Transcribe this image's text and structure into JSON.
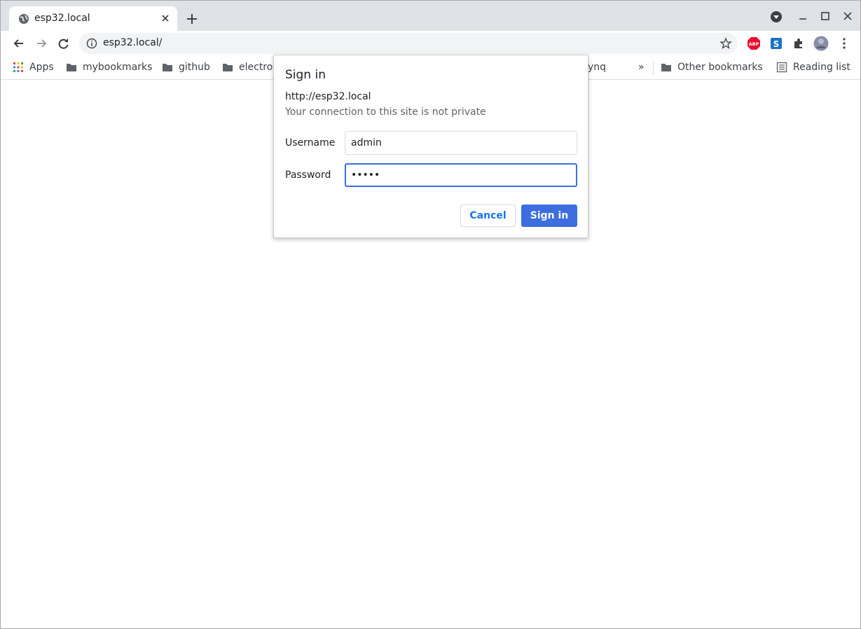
{
  "tab": {
    "title": "esp32.local"
  },
  "omnibox": {
    "url": "esp32.local/"
  },
  "bookmarks": {
    "items": [
      {
        "label": "Apps"
      },
      {
        "label": "mybookmarks"
      },
      {
        "label": "github"
      },
      {
        "label": "electron"
      },
      {
        "label": "ynq"
      }
    ],
    "overflow": "»",
    "other": "Other bookmarks",
    "reading_list": "Reading list"
  },
  "dialog": {
    "title": "Sign in",
    "origin": "http://esp32.local",
    "warning": "Your connection to this site is not private",
    "username_label": "Username",
    "username_value": "admin",
    "password_label": "Password",
    "password_value": "•••••",
    "cancel_label": "Cancel",
    "signin_label": "Sign in"
  },
  "colors": {
    "accent": "#3c6ee0",
    "tabstrip": "#dee1e6",
    "abp": "#e8112d",
    "ext_s": "#1a73c8"
  },
  "icons": [
    "globe-icon",
    "close-icon",
    "plus-icon",
    "dropdown-icon",
    "minimize-icon",
    "maximize-icon",
    "back-icon",
    "forward-icon",
    "reload-icon",
    "info-icon",
    "star-icon",
    "abp-icon",
    "s-extension-icon",
    "puzzle-icon",
    "avatar",
    "menu-icon",
    "apps-icon",
    "folder-icon",
    "reading-list-icon"
  ]
}
